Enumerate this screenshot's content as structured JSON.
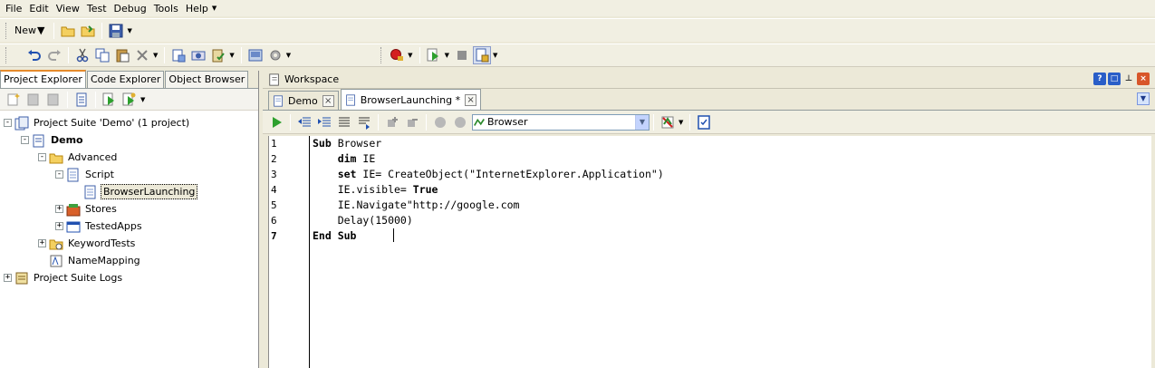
{
  "menu": [
    "File",
    "Edit",
    "View",
    "Test",
    "Debug",
    "Tools",
    "Help"
  ],
  "toolbar": {
    "new_label": "New"
  },
  "left_panel": {
    "tabs": [
      "Project Explorer",
      "Code Explorer",
      "Object Browser"
    ],
    "active_tab": "Project Explorer",
    "tree": [
      {
        "label": "Project Suite 'Demo' (1 project)",
        "level": 0,
        "expander": "-",
        "icon": "project-suite-icon"
      },
      {
        "label": "Demo",
        "level": 1,
        "expander": "-",
        "icon": "project-icon",
        "bold": true
      },
      {
        "label": "Advanced",
        "level": 2,
        "expander": "-",
        "icon": "folder-open-icon"
      },
      {
        "label": "Script",
        "level": 3,
        "expander": "-",
        "icon": "script-icon"
      },
      {
        "label": "BrowserLaunching",
        "level": 4,
        "expander": "",
        "icon": "script-unit-icon",
        "selected": true
      },
      {
        "label": "Stores",
        "level": 3,
        "expander": "+",
        "icon": "stores-icon"
      },
      {
        "label": "TestedApps",
        "level": 3,
        "expander": "+",
        "icon": "tested-apps-icon"
      },
      {
        "label": "KeywordTests",
        "level": 2,
        "expander": "+",
        "icon": "keyword-tests-icon"
      },
      {
        "label": "NameMapping",
        "level": 2,
        "expander": "",
        "icon": "name-mapping-icon"
      },
      {
        "label": "Project Suite Logs",
        "level": 0,
        "expander": "+",
        "icon": "logs-icon"
      }
    ]
  },
  "workspace": {
    "title": "Workspace",
    "tabs": [
      {
        "label": "Demo",
        "active": false
      },
      {
        "label": "BrowserLaunching *",
        "active": true
      }
    ],
    "routine_selector": "Browser"
  },
  "editor": {
    "current_line": 7,
    "lines": [
      {
        "n": "1",
        "parts": [
          [
            "kw",
            "Sub"
          ],
          [
            "t",
            " Browser"
          ]
        ]
      },
      {
        "n": "2",
        "parts": [
          [
            "t",
            "    "
          ],
          [
            "kw",
            "dim"
          ],
          [
            "t",
            " IE"
          ]
        ]
      },
      {
        "n": "3",
        "parts": [
          [
            "t",
            "    "
          ],
          [
            "kw",
            "set"
          ],
          [
            "t",
            " IE= CreateObject(\"InternetExplorer.Application\")"
          ]
        ]
      },
      {
        "n": "4",
        "parts": [
          [
            "t",
            "    IE.visible= "
          ],
          [
            "kw",
            "True"
          ]
        ]
      },
      {
        "n": "5",
        "parts": [
          [
            "t",
            "    IE.Navigate\"http://google.com"
          ]
        ]
      },
      {
        "n": "6",
        "parts": [
          [
            "t",
            "    Delay(15000)"
          ]
        ]
      },
      {
        "n": "7",
        "parts": [
          [
            "kw",
            "End Sub"
          ]
        ]
      }
    ]
  },
  "colors": {
    "chrome": "#ECE9D8",
    "tab_accent": "#E68B2C",
    "selection": "#ECE9D8"
  }
}
